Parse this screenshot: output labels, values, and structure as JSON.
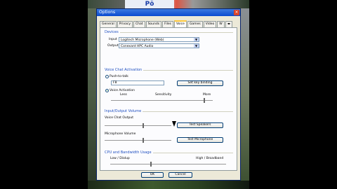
{
  "background_ad": "Pö",
  "window": {
    "title": "Options",
    "close": "×"
  },
  "tabs": [
    "General",
    "Privacy",
    "Chat",
    "Sounds",
    "Files",
    "Voice",
    "Games",
    "Video",
    "W"
  ],
  "tab_overflow": "◂▸",
  "devices": {
    "label": "Devices",
    "input_label": "Input",
    "input_value": "Logitech Microphone (Web)",
    "output_label": "Output",
    "output_value": "Conexant HPC Audio"
  },
  "voice_activation": {
    "label": "Voice Chat Activation",
    "push_to_talk": "Push-to-talk",
    "key_value": "F8",
    "set_key": "Set key binding",
    "voice_activation": "Voice Activation",
    "less": "Less",
    "sensitivity": "Sensitivity",
    "more": "More",
    "sensitivity_level": 0.92
  },
  "io_volume": {
    "label": "Input/Output Volume",
    "voice_chat_output": "Voice Chat Output",
    "test_speakers": "Test Speakers",
    "microphone_volume": "Microphone Volume",
    "test_microphone": "Test Microphone",
    "output_level": 0.58,
    "mic_level": 0.58
  },
  "bandwidth": {
    "label": "CPU and Bandwidth Usage",
    "low": "Low / Dialup",
    "high": "High / Broadband",
    "level": 0.35
  },
  "footer": {
    "ok": "OK",
    "cancel": "Cancel"
  }
}
